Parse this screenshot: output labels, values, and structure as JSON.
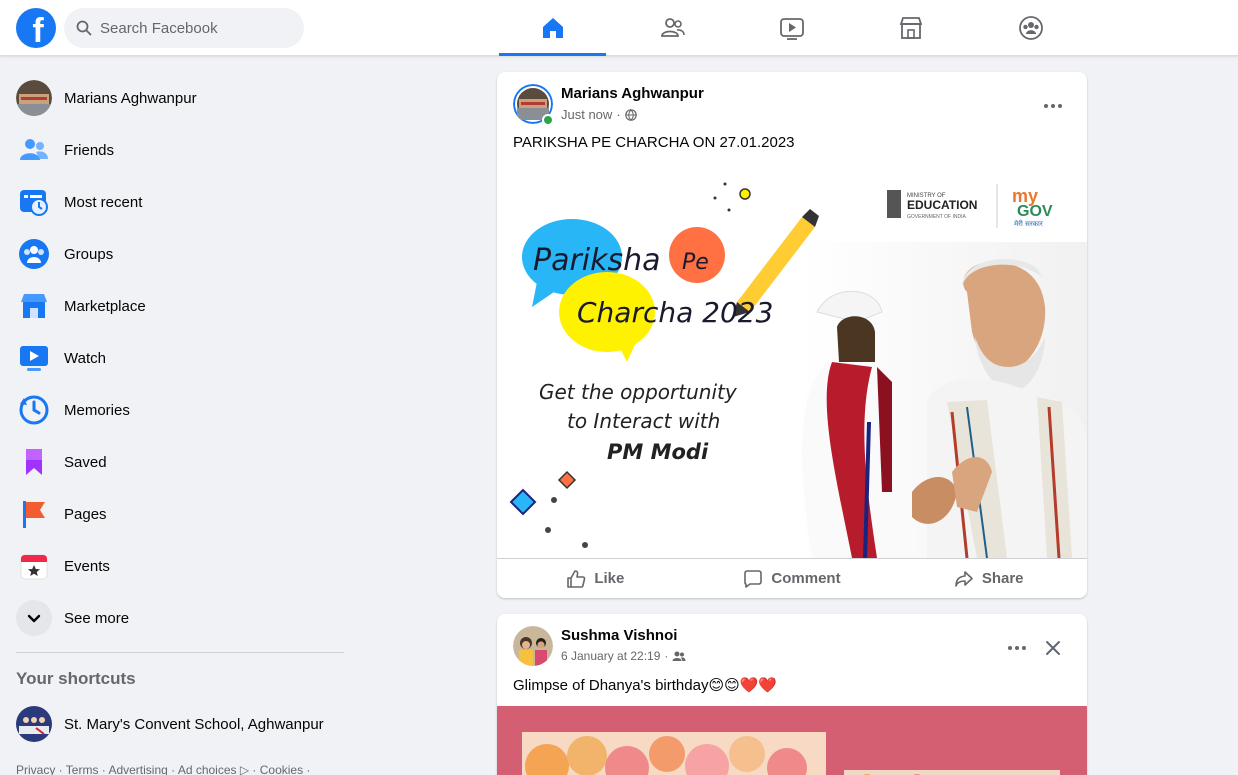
{
  "topbar": {
    "logo_letter": "f",
    "search_placeholder": "Search Facebook"
  },
  "sidebar": {
    "items": [
      {
        "label": "Marians Aghwanpur"
      },
      {
        "label": "Friends"
      },
      {
        "label": "Most recent"
      },
      {
        "label": "Groups"
      },
      {
        "label": "Marketplace"
      },
      {
        "label": "Watch"
      },
      {
        "label": "Memories"
      },
      {
        "label": "Saved"
      },
      {
        "label": "Pages"
      },
      {
        "label": "Events"
      },
      {
        "label": "See more"
      }
    ],
    "shortcuts_title": "Your shortcuts",
    "shortcuts": [
      {
        "label": "St. Mary's Convent School, Aghwanpur"
      }
    ],
    "footer": "Privacy · Terms · Advertising · Ad choices ▷ · Cookies ·"
  },
  "posts": [
    {
      "author": "Marians Aghwanpur",
      "time": "Just now",
      "text": "PARIKSHA PE CHARCHA ON 27.01.2023",
      "image": {
        "ministry_small": "MINISTRY OF",
        "ministry_big": "EDUCATION",
        "ministry_sub": "GOVERNMENT OF INDIA",
        "mygov_my": "my",
        "mygov_gov": "GOV",
        "mygov_sub": "मेरी सरकार",
        "bubble1": "Pariksha",
        "bubble_pe": "Pe",
        "bubble2": "Charcha 2023",
        "line1": "Get the opportunity",
        "line2": "to Interact with",
        "line3": "PM Modi"
      },
      "actions": {
        "like": "Like",
        "comment": "Comment",
        "share": "Share"
      }
    },
    {
      "author": "Sushma Vishnoi",
      "time": "6 January at 22:19",
      "text": "Glimpse of Dhanya's birthday😊😊❤️❤️"
    }
  ],
  "colors": {
    "brand": "#1877f2",
    "background": "#f0f2f5",
    "secondary_text": "#65676b"
  }
}
